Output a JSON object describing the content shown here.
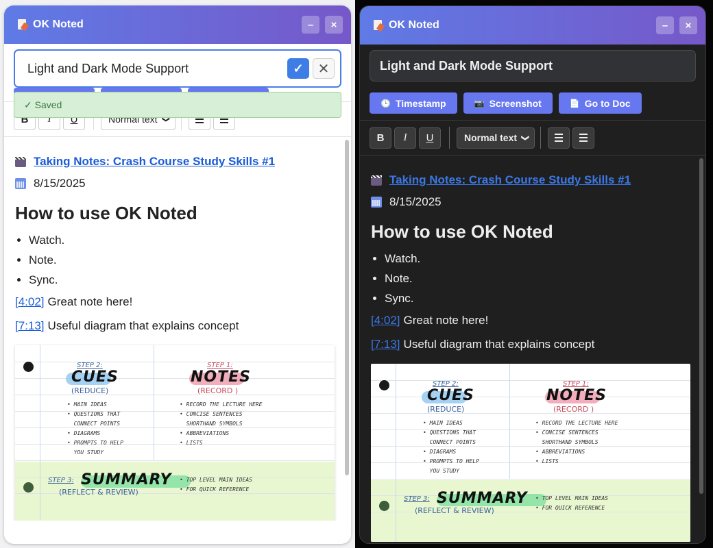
{
  "app": {
    "title": "OK Noted",
    "minimize_label": "–",
    "close_label": "×"
  },
  "note_title": "Light and Dark Mode Support",
  "title_confirm": "✓",
  "title_cancel": "✕",
  "saved_message": "✓ Saved",
  "actions": {
    "timestamp": "Timestamp",
    "screenshot": "Screenshot",
    "go_to_doc": "Go to Doc"
  },
  "toolbar": {
    "bold": "B",
    "italic": "I",
    "underline": "U",
    "text_style": "Normal text"
  },
  "content": {
    "video_title": "Taking Notes: Crash Course Study Skills #1",
    "date": "8/15/2025",
    "heading": "How to use OK Noted",
    "bullets": [
      "Watch.",
      "Note.",
      "Sync."
    ],
    "notes": [
      {
        "time": "[4:02]",
        "text": "Great note here!"
      },
      {
        "time": "[7:13]",
        "text": "Useful diagram that explains concept"
      }
    ]
  },
  "diagram": {
    "step2": "STEP 2:",
    "cues": "CUES",
    "reduce": "(REDUCE)",
    "cues_items": "• MAIN IDEAS\n• QUESTIONS THAT\n  CONNECT POINTS\n• DIAGRAMS\n• PROMPTS TO HELP\n  YOU STUDY",
    "step1": "STEP 1:",
    "notes": "NOTES",
    "record": "(RECORD )",
    "notes_items": "• RECORD THE LECTURE HERE\n• CONCISE SENTENCES\n  SHORTHAND SYMBOLS\n• ABBREVIATIONS\n• LISTS",
    "step3": "STEP 3:",
    "summary": "SUMMARY",
    "reflect": "(REFLECT & REVIEW)",
    "summary_items": "• TOP LEVEL MAIN IDEAS\n• FOR QUICK REFERENCE"
  },
  "colors": {
    "title_gradient_start": "#5f7be6",
    "title_gradient_end": "#7658c9",
    "action_button": "#6777f0",
    "link": "#1a5bd7",
    "saved_bg": "#d7efd6"
  }
}
